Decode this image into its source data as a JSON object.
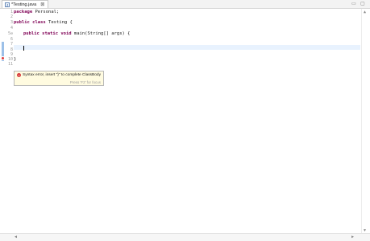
{
  "tab": {
    "icon": "J",
    "title": "*Testing.java",
    "close": "⊠"
  },
  "window_controls": {
    "minimize": "▭",
    "maximize": "▢"
  },
  "line_numbers": [
    "1",
    "2",
    "3",
    "4",
    "5⊖",
    "6",
    "7",
    "8",
    "9",
    "10",
    "11"
  ],
  "code_lines": [
    {
      "kw": "package",
      "rest": " Personal;"
    },
    {
      "kw": "",
      "rest": ""
    },
    {
      "kw": "public class",
      "rest": " Testing {"
    },
    {
      "kw": "",
      "rest": ""
    },
    {
      "kw": "public static void",
      "rest": " main(String[] args) {",
      "indent": "    "
    },
    {
      "kw": "",
      "rest": ""
    },
    {
      "kw": "",
      "rest": ""
    },
    {
      "kw": "",
      "rest": ""
    },
    {
      "kw": "",
      "rest": ""
    },
    {
      "kw": "",
      "rest": "}"
    },
    {
      "kw": "",
      "rest": ""
    }
  ],
  "tooltip": {
    "message": "Syntax error, insert \"}\" to complete ClassBody",
    "hint": "Press 'F2' for focus"
  },
  "scroll": {
    "up": "▲",
    "down": "▼",
    "left": "◀",
    "right": "▶"
  }
}
